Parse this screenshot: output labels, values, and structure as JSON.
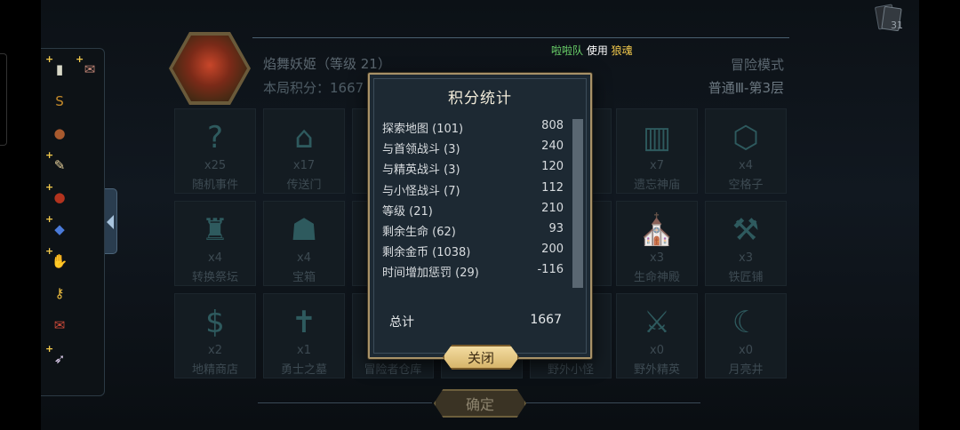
{
  "ticker": {
    "who": "啦啦队",
    "mid": " 使用 ",
    "what": "狼魂"
  },
  "cards_count": "31",
  "inventory": {
    "items": [
      {
        "icon": "milestone-icon",
        "glyph": "▮",
        "color": "#d9d9c8",
        "plus": "+"
      },
      {
        "icon": "scroll-bundle-icon",
        "glyph": "✉",
        "color": "#c98a7a",
        "plus": "+"
      },
      {
        "icon": "gold-bag-icon",
        "glyph": "S",
        "color": "#c48a2a",
        "plus": ""
      },
      {
        "icon": "meat-icon",
        "glyph": "●",
        "color": "#a85a2e",
        "plus": ""
      },
      {
        "icon": "parchment-icon",
        "glyph": "✎",
        "color": "#e5cf9b",
        "plus": "+"
      },
      {
        "icon": "potion-icon",
        "glyph": "●",
        "color": "#b2331e",
        "plus": "+"
      },
      {
        "icon": "gem-scroll-icon",
        "glyph": "◆",
        "color": "#4a7ad8",
        "plus": "+"
      },
      {
        "icon": "gauntlet-icon",
        "glyph": "✋",
        "color": "#e0a12e",
        "plus": "+"
      },
      {
        "icon": "golden-key-icon",
        "glyph": "⚷",
        "color": "#f0c040",
        "plus": ""
      },
      {
        "icon": "sealed-scroll-icon",
        "glyph": "✉",
        "color": "#d04a3a",
        "plus": ""
      },
      {
        "icon": "feather-icon",
        "glyph": "➶",
        "color": "#e0d0f0",
        "plus": "+"
      }
    ]
  },
  "hero": {
    "name": "焰舞妖姬（等级 21）",
    "score_label": "本局积分：1667",
    "mode": "冒险模式",
    "floor": "普通Ⅲ-第3层"
  },
  "tiles": [
    {
      "glyph": "?",
      "count": "x25",
      "label": "随机事件"
    },
    {
      "glyph": "⌂",
      "count": "x17",
      "label": "传送门"
    },
    {
      "glyph": "",
      "count": "",
      "label": ""
    },
    {
      "glyph": "",
      "count": "",
      "label": ""
    },
    {
      "glyph": "",
      "count": "",
      "label": ""
    },
    {
      "glyph": "▥",
      "count": "x7",
      "label": "遗忘神庙"
    },
    {
      "glyph": "⬡",
      "count": "x4",
      "label": "空格子"
    },
    {
      "glyph": "♜",
      "count": "x4",
      "label": "转换祭坛"
    },
    {
      "glyph": "☗",
      "count": "x4",
      "label": "宝箱"
    },
    {
      "glyph": "",
      "count": "",
      "label": ""
    },
    {
      "glyph": "",
      "count": "",
      "label": ""
    },
    {
      "glyph": "",
      "count": "",
      "label": ""
    },
    {
      "glyph": "⛪",
      "count": "x3",
      "label": "生命神殿"
    },
    {
      "glyph": "⚒",
      "count": "x3",
      "label": "铁匠铺"
    },
    {
      "glyph": "$",
      "count": "x2",
      "label": "地精商店"
    },
    {
      "glyph": "✝",
      "count": "x1",
      "label": "勇士之墓"
    },
    {
      "glyph": "",
      "count": "",
      "label": "冒险者仓库"
    },
    {
      "glyph": "",
      "count": "",
      "label": ""
    },
    {
      "glyph": "",
      "count": "",
      "label": "野外小怪"
    },
    {
      "glyph": "⚔",
      "count": "x0",
      "label": "野外精英"
    },
    {
      "glyph": "☾",
      "count": "x0",
      "label": "月亮井"
    }
  ],
  "confirm_label": "确定",
  "dialog": {
    "title": "积分统计",
    "rows": [
      {
        "label": "探索地图 (101)",
        "value": "808"
      },
      {
        "label": "与首领战斗 (3)",
        "value": "240"
      },
      {
        "label": "与精英战斗 (3)",
        "value": "120"
      },
      {
        "label": "与小怪战斗 (7)",
        "value": "112"
      },
      {
        "label": "等级 (21)",
        "value": "210"
      },
      {
        "label": "剩余生命 (62)",
        "value": "93"
      },
      {
        "label": "剩余金币 (1038)",
        "value": "200"
      },
      {
        "label": "时间增加惩罚 (29)",
        "value": "-116"
      }
    ],
    "total_label": "总计",
    "total_value": "1667",
    "close_label": "关闭"
  }
}
